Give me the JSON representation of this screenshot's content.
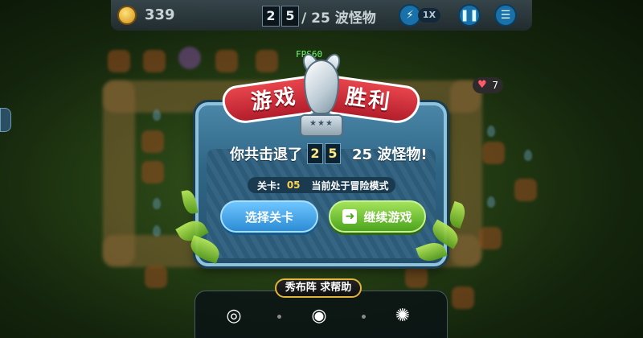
{
  "hud": {
    "coins": "339",
    "wave_current_digits": [
      "2",
      "5"
    ],
    "wave_total_text": "/ 25 波怪物",
    "speed_label": "1X",
    "pause_icon": "pause-icon",
    "menu_icon": "menu-icon",
    "boost_icon": "lightning-icon",
    "heart_count": "7"
  },
  "debug": {
    "fps_label": "FPS60"
  },
  "dialog": {
    "title_left": "游戏",
    "title_right": "胜利",
    "trophy_stars": "★★★",
    "message_prefix": "你共击退了",
    "message_digits": [
      "2",
      "5"
    ],
    "message_suffix": "25 波怪物!",
    "level_label": "关卡:",
    "level_value": "05",
    "mode_text": "当前处于冒险模式",
    "select_button": "选择关卡",
    "continue_button": "继续游戏"
  },
  "share": {
    "label": "秀布阵 求帮助",
    "icons": [
      "weibo-icon",
      "wechat-icon",
      "camera-shutter-icon"
    ]
  },
  "colors": {
    "ribbon_red": "#d9323d",
    "panel_blue": "#2f6686",
    "continue_green": "#4ba41d",
    "select_blue": "#2c8cd5",
    "share_border_gold": "#e2b43a"
  }
}
